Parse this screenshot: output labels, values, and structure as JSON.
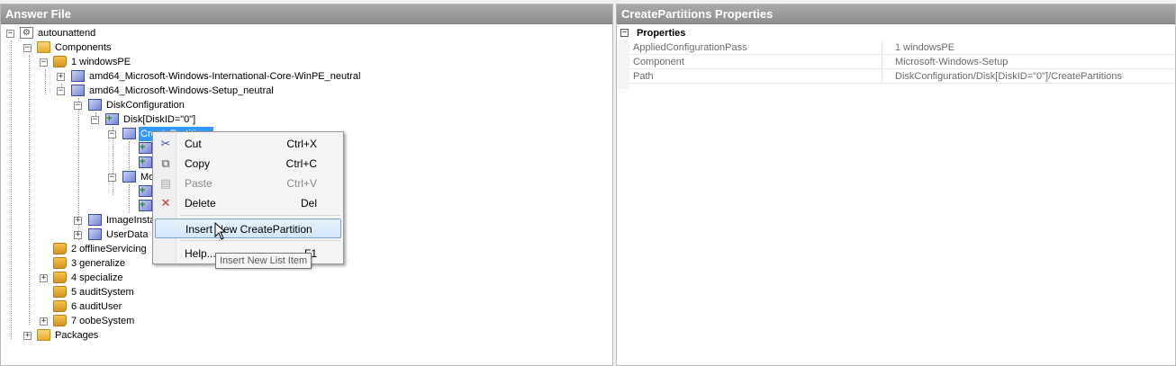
{
  "answer_file": {
    "title": "Answer File",
    "tree": {
      "root": "autounattend",
      "components": "Components",
      "windowsPE": "1 windowsPE",
      "intl": "amd64_Microsoft-Windows-International-Core-WinPE_neutral",
      "setup": "amd64_Microsoft-Windows-Setup_neutral",
      "diskconfig": "DiskConfiguration",
      "disk": "Disk[DiskID=\"0\"]",
      "createpartitions": "CreatePartitions",
      "modify_partial": "Mo",
      "imageinstall": "ImageInstall",
      "userdata": "UserData",
      "offline": "2 offlineServicing",
      "generalize": "3 generalize",
      "specialize": "4 specialize",
      "auditsystem": "5 auditSystem",
      "audituser": "6 auditUser",
      "oobe": "7 oobeSystem",
      "packages": "Packages"
    }
  },
  "properties": {
    "title": "CreatePartitions Properties",
    "section": "Properties",
    "rows": [
      {
        "key": "AppliedConfigurationPass",
        "value": "1 windowsPE"
      },
      {
        "key": "Component",
        "value": "Microsoft-Windows-Setup"
      },
      {
        "key": "Path",
        "value": "DiskConfiguration/Disk[DiskID=\"0\"]/CreatePartitions"
      }
    ]
  },
  "context_menu": {
    "items": [
      {
        "label": "Cut",
        "shortcut": "Ctrl+X",
        "icon": "scissors-icon"
      },
      {
        "label": "Copy",
        "shortcut": "Ctrl+C",
        "icon": "copy-icon"
      },
      {
        "label": "Paste",
        "shortcut": "Ctrl+V",
        "icon": "paste-icon",
        "disabled": true
      },
      {
        "label": "Delete",
        "shortcut": "Del",
        "icon": "delete-icon"
      },
      {
        "label": "Insert New CreatePartition",
        "shortcut": "",
        "highlighted": true
      },
      {
        "label": "Help...",
        "shortcut": "F1"
      }
    ]
  },
  "tooltip": "Insert New List Item"
}
